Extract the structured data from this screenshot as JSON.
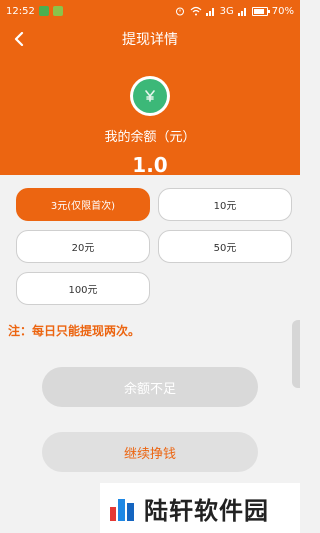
{
  "status": {
    "time": "12:52",
    "network": "3G",
    "battery": "70%"
  },
  "header": {
    "title": "提现详情",
    "balance_label": "我的余额（元）",
    "balance_value": "1.0"
  },
  "amounts": [
    {
      "label": "3元(仅限首次)",
      "selected": true
    },
    {
      "label": "10元",
      "selected": false
    },
    {
      "label": "20元",
      "selected": false
    },
    {
      "label": "50元",
      "selected": false
    },
    {
      "label": "100元",
      "selected": false
    }
  ],
  "notice": "注：每日只能提现两次。",
  "buttons": {
    "insufficient": "余额不足",
    "continue": "继续挣钱"
  },
  "watermark": {
    "text": "陆轩软件园"
  },
  "colors": {
    "accent": "#ec6511",
    "coin": "#3cb878"
  }
}
